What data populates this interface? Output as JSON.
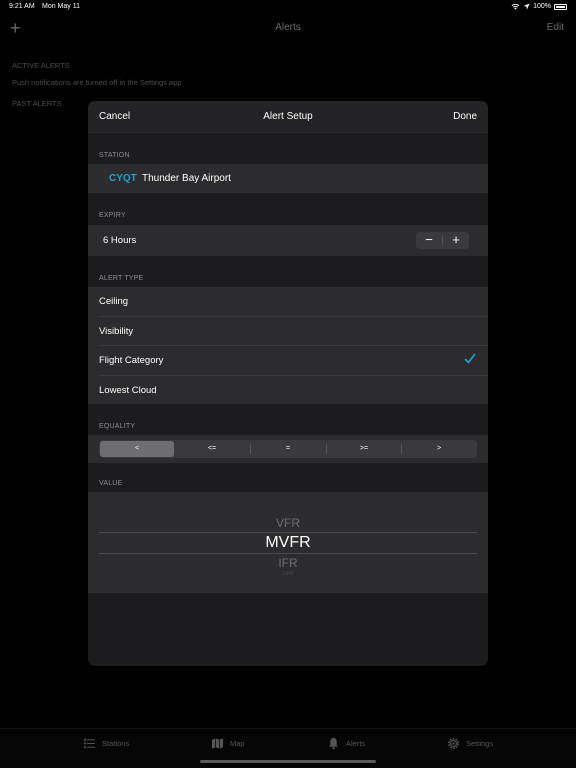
{
  "status_bar": {
    "time": "9:21 AM",
    "date": "Mon May 11",
    "battery": "100%"
  },
  "background": {
    "nav_title": "Alerts",
    "nav_add": "+",
    "nav_edit": "Edit",
    "active_alerts_label": "ACTIVE ALERTS",
    "push_note": "Push notifications are turned off in the Settings app",
    "past_alerts_label": "PAST ALERTS"
  },
  "tab_bar": {
    "tabs": [
      {
        "label": "Stations",
        "icon": "list-icon"
      },
      {
        "label": "Map",
        "icon": "map-icon"
      },
      {
        "label": "Alerts",
        "icon": "bell-icon"
      },
      {
        "label": "Settings",
        "icon": "gear-icon"
      }
    ]
  },
  "modal": {
    "title": "Alert Setup",
    "cancel": "Cancel",
    "done": "Done",
    "station": {
      "label": "STATION",
      "code": "CYQT",
      "name": "Thunder Bay Airport"
    },
    "expiry": {
      "label": "EXPIRY",
      "value": "6 Hours",
      "minus": "−",
      "plus": "+"
    },
    "alert_type": {
      "label": "ALERT TYPE",
      "options": [
        "Ceiling",
        "Visibility",
        "Flight Category",
        "Lowest Cloud"
      ],
      "selected": "Flight Category"
    },
    "equality": {
      "label": "EQUALITY",
      "options": [
        "<",
        "<=",
        "=",
        ">=",
        ">"
      ],
      "selected": "<"
    },
    "value": {
      "label": "VALUE",
      "above": "VFR",
      "selected": "MVFR",
      "below": "IFR",
      "below2": "LIFR"
    }
  },
  "colors": {
    "accent": "#1ea1d9",
    "background": "#000000",
    "modal": "#1c1c1e",
    "cell": "#2c2c2e"
  }
}
